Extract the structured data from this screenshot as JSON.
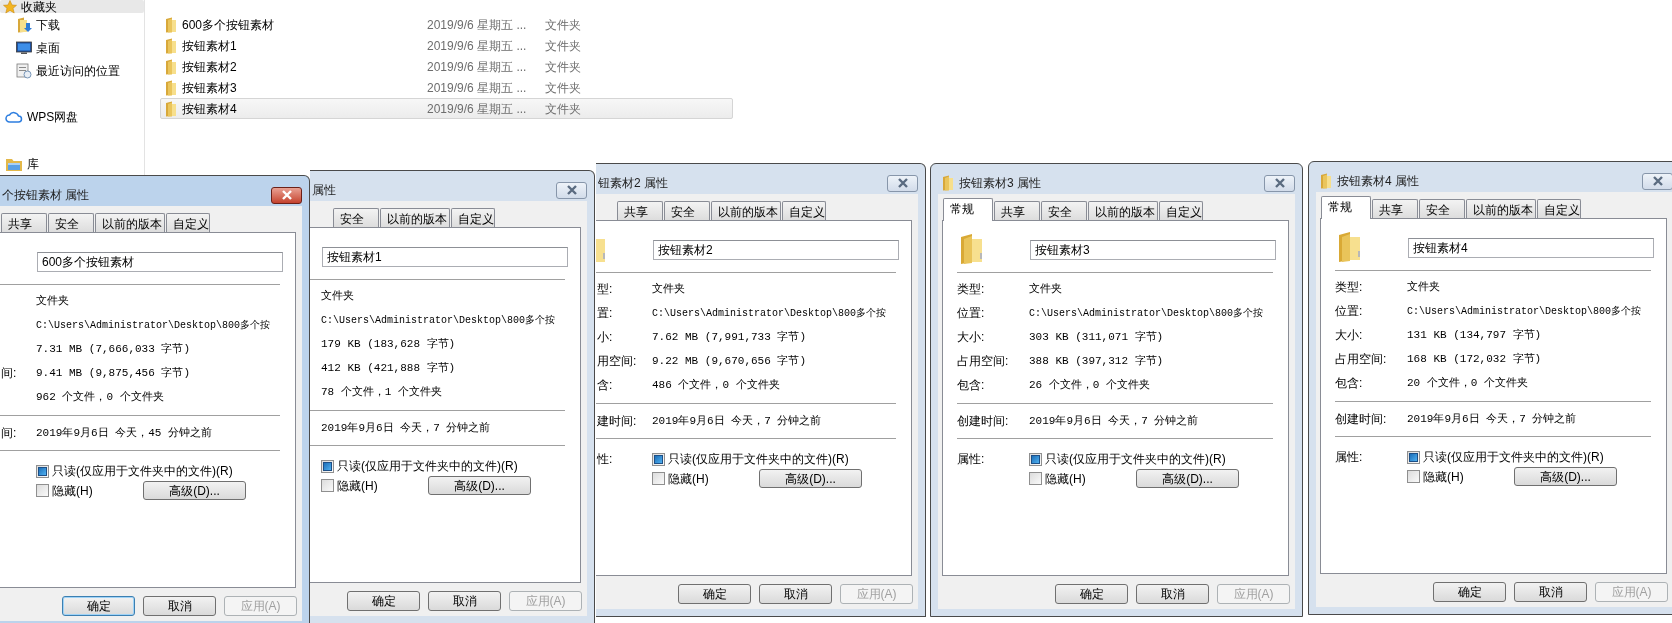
{
  "sidebar": [
    {
      "kind": "favorites",
      "label": "收藏夹",
      "selected": true,
      "children": [
        {
          "kind": "downloads",
          "label": "下载",
          "selected": false
        },
        {
          "kind": "desktop",
          "label": "桌面",
          "selected": false
        },
        {
          "kind": "recent",
          "label": "最近访问的位置",
          "selected": false
        }
      ]
    },
    {
      "kind": "cloud",
      "label": "WPS网盘",
      "selected": false
    },
    {
      "kind": "library",
      "label": "库",
      "selected": false
    }
  ],
  "files": [
    {
      "name": "600多个按钮素材",
      "date": "2019/9/6 星期五 ...",
      "type": "文件夹",
      "selected": false
    },
    {
      "name": "按钮素材1",
      "date": "2019/9/6 星期五 ...",
      "type": "文件夹",
      "selected": false
    },
    {
      "name": "按钮素材2",
      "date": "2019/9/6 星期五 ...",
      "type": "文件夹",
      "selected": false
    },
    {
      "name": "按钮素材3",
      "date": "2019/9/6 星期五 ...",
      "type": "文件夹",
      "selected": false
    },
    {
      "name": "按钮素材4",
      "date": "2019/9/6 星期五 ...",
      "type": "文件夹",
      "selected": true
    }
  ],
  "dialogs": [
    {
      "title": "个按钮素材 属性",
      "active": true,
      "tabs": [
        {
          "label": "共享",
          "selected": false
        },
        {
          "label": "安全",
          "selected": false
        },
        {
          "label": "以前的版本",
          "selected": false
        },
        {
          "label": "自定义",
          "selected": false
        }
      ],
      "name_value": "600多个按钮素材",
      "rows": [
        {
          "value": "文件夹"
        },
        {
          "value": "C:\\Users\\Administrator\\Desktop\\800多个按"
        },
        {
          "value": "7.31 MB (7,666,033 字节)"
        },
        {
          "label": "间:",
          "value": "9.41 MB (9,875,456 字节)"
        },
        {
          "value": "962 个文件，0 个文件夹"
        }
      ],
      "created": {
        "label": "间:",
        "value": "2019年9月6日 今天，45 分钟之前"
      },
      "attributes": {
        "checkboxes": [
          {
            "label": "只读(仅应用于文件夹中的文件)(R)",
            "checked": true
          },
          {
            "label": "隐藏(H)",
            "checked": false
          }
        ]
      },
      "advanced_button": "高级(D)...",
      "buttons": [
        {
          "label": "确定",
          "disabled": false,
          "focused": true
        },
        {
          "label": "取消",
          "disabled": false,
          "focused": false
        },
        {
          "label": "应用(A)",
          "disabled": true,
          "focused": false
        }
      ]
    },
    {
      "title": "属性",
      "active": false,
      "tabs": [
        {
          "label": "安全",
          "selected": false
        },
        {
          "label": "以前的版本",
          "selected": false
        },
        {
          "label": "自定义",
          "selected": false
        }
      ],
      "name_value": "按钮素材1",
      "rows": [
        {
          "value": "文件夹"
        },
        {
          "value": "C:\\Users\\Administrator\\Desktop\\800多个按"
        },
        {
          "value": "179 KB (183,628 字节)"
        },
        {
          "value": "412 KB (421,888 字节)"
        },
        {
          "value": "78 个文件，1 个文件夹"
        }
      ],
      "created": {
        "value": "2019年9月6日 今天，7 分钟之前"
      },
      "attributes": {
        "checkboxes": [
          {
            "label": "只读(仅应用于文件夹中的文件)(R)",
            "checked": true
          },
          {
            "label": "隐藏(H)",
            "checked": false
          }
        ]
      },
      "advanced_button": "高级(D)...",
      "buttons": [
        {
          "label": "确定",
          "disabled": false,
          "focused": false
        },
        {
          "label": "取消",
          "disabled": false,
          "focused": false
        },
        {
          "label": "应用(A)",
          "disabled": true,
          "focused": false
        }
      ]
    },
    {
      "title": "钮素材2 属性",
      "active": false,
      "tabs": [
        {
          "label": "共享",
          "selected": false
        },
        {
          "label": "安全",
          "selected": false
        },
        {
          "label": "以前的版本",
          "selected": false
        },
        {
          "label": "自定义",
          "selected": false
        }
      ],
      "name_value": "按钮素材2",
      "rows": [
        {
          "label": "型:",
          "value": "文件夹"
        },
        {
          "label": "置:",
          "value": "C:\\Users\\Administrator\\Desktop\\800多个按"
        },
        {
          "label": "小:",
          "value": "7.62 MB (7,991,733 字节)"
        },
        {
          "label": "用空间:",
          "value": "9.22 MB (9,670,656 字节)"
        },
        {
          "label": "含:",
          "value": "486 个文件，0 个文件夹"
        }
      ],
      "created": {
        "label": "建时间:",
        "value": "2019年9月6日 今天，7 分钟之前"
      },
      "attributes": {
        "label": "性:",
        "checkboxes": [
          {
            "label": "只读(仅应用于文件夹中的文件)(R)",
            "checked": true
          },
          {
            "label": "隐藏(H)",
            "checked": false
          }
        ]
      },
      "advanced_button": "高级(D)...",
      "buttons": [
        {
          "label": "确定",
          "disabled": false,
          "focused": false
        },
        {
          "label": "取消",
          "disabled": false,
          "focused": false
        },
        {
          "label": "应用(A)",
          "disabled": true,
          "focused": false
        }
      ]
    },
    {
      "title": "按钮素材3 属性",
      "active": false,
      "tabs": [
        {
          "label": "常规",
          "selected": true
        },
        {
          "label": "共享",
          "selected": false
        },
        {
          "label": "安全",
          "selected": false
        },
        {
          "label": "以前的版本",
          "selected": false
        },
        {
          "label": "自定义",
          "selected": false
        }
      ],
      "name_value": "按钮素材3",
      "rows": [
        {
          "label": "类型:",
          "value": "文件夹"
        },
        {
          "label": "位置:",
          "value": "C:\\Users\\Administrator\\Desktop\\800多个按"
        },
        {
          "label": "大小:",
          "value": "303 KB (311,071 字节)"
        },
        {
          "label": "占用空间:",
          "value": "388 KB (397,312 字节)"
        },
        {
          "label": "包含:",
          "value": "26 个文件，0 个文件夹"
        }
      ],
      "created": {
        "label": "创建时间:",
        "value": "2019年9月6日 今天，7 分钟之前"
      },
      "attributes": {
        "label": "属性:",
        "checkboxes": [
          {
            "label": "只读(仅应用于文件夹中的文件)(R)",
            "checked": true
          },
          {
            "label": "隐藏(H)",
            "checked": false
          }
        ]
      },
      "advanced_button": "高级(D)...",
      "buttons": [
        {
          "label": "确定",
          "disabled": false,
          "focused": false
        },
        {
          "label": "取消",
          "disabled": false,
          "focused": false
        },
        {
          "label": "应用(A)",
          "disabled": true,
          "focused": false
        }
      ]
    },
    {
      "title": "按钮素材4 属性",
      "active": false,
      "tabs": [
        {
          "label": "常规",
          "selected": true
        },
        {
          "label": "共享",
          "selected": false
        },
        {
          "label": "安全",
          "selected": false
        },
        {
          "label": "以前的版本",
          "selected": false
        },
        {
          "label": "自定义",
          "selected": false
        }
      ],
      "name_value": "按钮素材4",
      "rows": [
        {
          "label": "类型:",
          "value": "文件夹"
        },
        {
          "label": "位置:",
          "value": "C:\\Users\\Administrator\\Desktop\\800多个按"
        },
        {
          "label": "大小:",
          "value": "131 KB (134,797 字节)"
        },
        {
          "label": "占用空间:",
          "value": "168 KB (172,032 字节)"
        },
        {
          "label": "包含:",
          "value": "20 个文件，0 个文件夹"
        }
      ],
      "created": {
        "label": "创建时间:",
        "value": "2019年9月6日 今天，7 分钟之前"
      },
      "attributes": {
        "label": "属性:",
        "checkboxes": [
          {
            "label": "只读(仅应用于文件夹中的文件)(R)",
            "checked": true
          },
          {
            "label": "隐藏(H)",
            "checked": false
          }
        ]
      },
      "advanced_button": "高级(D)...",
      "buttons": [
        {
          "label": "确定",
          "disabled": false,
          "focused": false
        },
        {
          "label": "取消",
          "disabled": false,
          "focused": false
        },
        {
          "label": "应用(A)",
          "disabled": true,
          "focused": false
        }
      ]
    }
  ]
}
